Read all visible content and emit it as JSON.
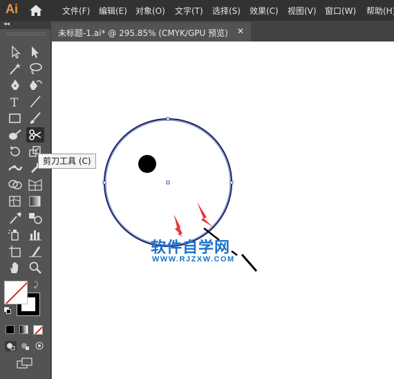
{
  "app": {
    "logo_text": "Ai"
  },
  "menu": [
    {
      "label": "文件(F)"
    },
    {
      "label": "编辑(E)"
    },
    {
      "label": "对象(O)"
    },
    {
      "label": "文字(T)"
    },
    {
      "label": "选择(S)"
    },
    {
      "label": "效果(C)"
    },
    {
      "label": "视图(V)"
    },
    {
      "label": "窗口(W)"
    },
    {
      "label": "帮助(H)"
    }
  ],
  "panel": {
    "collapse_glyph": "◂◂"
  },
  "tools": [
    {
      "name": "selection-tool-icon"
    },
    {
      "name": "direct-selection-tool-icon"
    },
    {
      "name": "magic-wand-tool-icon"
    },
    {
      "name": "lasso-tool-icon"
    },
    {
      "name": "pen-tool-icon"
    },
    {
      "name": "curvature-tool-icon"
    },
    {
      "name": "type-tool-icon"
    },
    {
      "name": "line-segment-tool-icon"
    },
    {
      "name": "rectangle-tool-icon"
    },
    {
      "name": "paintbrush-tool-icon"
    },
    {
      "name": "blob-brush-tool-icon"
    },
    {
      "name": "scissors-tool-icon",
      "active": true
    },
    {
      "name": "rotate-tool-icon"
    },
    {
      "name": "scale-tool-icon"
    },
    {
      "name": "width-tool-icon"
    },
    {
      "name": "puppet-warp-tool-icon"
    },
    {
      "name": "shape-builder-tool-icon"
    },
    {
      "name": "perspective-grid-tool-icon"
    },
    {
      "name": "mesh-tool-icon"
    },
    {
      "name": "gradient-tool-icon"
    },
    {
      "name": "eyedropper-tool-icon"
    },
    {
      "name": "blend-tool-icon"
    },
    {
      "name": "symbol-sprayer-tool-icon"
    },
    {
      "name": "column-graph-tool-icon"
    },
    {
      "name": "artboard-tool-icon"
    },
    {
      "name": "slice-tool-icon"
    },
    {
      "name": "hand-tool-icon"
    },
    {
      "name": "zoom-tool-icon"
    }
  ],
  "tab": {
    "title": "未标题-1.ai* @ 295.85% (CMYK/GPU 预览)",
    "close_glyph": "✕"
  },
  "tooltip": {
    "text": "剪刀工具 (C)"
  },
  "watermark": {
    "title": "软件自学网",
    "url": "WWW.RJZXW.COM"
  },
  "colors": {
    "menubar": "#323232",
    "panel": "#535353",
    "canvas": "#ffffff",
    "circle_stroke": "#1b2a6e",
    "arrow": "#e83a3a",
    "watermark": "#1a73c9",
    "logo": "#e69a4d"
  }
}
